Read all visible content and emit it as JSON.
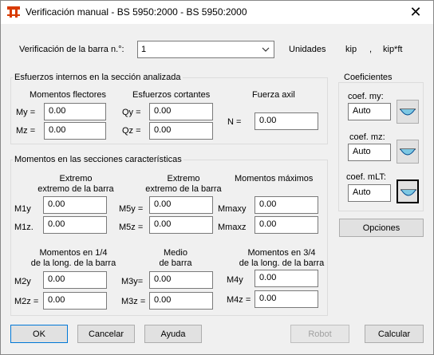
{
  "window": {
    "title": "Verificación manual - BS 5950:2000 - BS 5950:2000"
  },
  "header": {
    "bar_label": "Verificación de la barra n.°:",
    "bar_value": "1",
    "units_label": "Unidades",
    "unit_force": "kip",
    "unit_separator": ",",
    "unit_moment": "kip*ft"
  },
  "internal": {
    "title": "Esfuerzos internos en la sección analizada",
    "moments_title": "Momentos flectores",
    "shear_title": "Esfuerzos cortantes",
    "axial_title": "Fuerza axil",
    "my_label": "My =",
    "mz_label": "Mz =",
    "qy_label": "Qy =",
    "qz_label": "Qz =",
    "n_label": "N =",
    "my_value": "0.00",
    "mz_value": "0.00",
    "qy_value": "0.00",
    "qz_value": "0.00",
    "n_value": "0.00"
  },
  "sections": {
    "title": "Momentos en las secciones características",
    "col1_title_l1": "Extremo",
    "col1_title_l2": "extremo de la barra",
    "col2_title_l1": "Extremo",
    "col2_title_l2": "extremo de la barra",
    "col3_title": "Momentos máximos",
    "m1y_label": "M1y",
    "m1z_label": "M1z.",
    "m5y_label": "M5y =",
    "m5z_label": "M5z =",
    "mmaxy_label": "Mmaxy",
    "mmaxz_label": "Mmaxz",
    "m1y_value": "0.00",
    "m1z_value": "0.00",
    "m5y_value": "0.00",
    "m5z_value": "0.00",
    "mmaxy_value": "0.00",
    "mmaxz_value": "0.00",
    "col4_title_l1": "Momentos en 1/4",
    "col4_title_l2": "de la long. de la barra",
    "col5_title_l1": "Medio",
    "col5_title_l2": "de barra",
    "col6_title_l1": "Momentos en 3/4",
    "col6_title_l2": "de la long. de la barra",
    "m2y_label": "M2y",
    "m2z_label": "M2z =",
    "m3y_label": "M3y=",
    "m3z_label": "M3z =",
    "m4y_label": "M4y",
    "m4z_label": "M4z =",
    "m2y_value": "0.00",
    "m2z_value": "0.00",
    "m3y_value": "0.00",
    "m3z_value": "0.00",
    "m4y_value": "0.00",
    "m4z_value": "0.00"
  },
  "coefficients": {
    "title": "Coeficientes",
    "my_label": "coef. my:",
    "mz_label": "coef. mz:",
    "mlt_label": "coef. mLT:",
    "my_value": "Auto",
    "mz_value": "Auto",
    "mlt_value": "Auto",
    "diagram_icon": "moment-diagram-icon",
    "options_button": "Opciones"
  },
  "footer": {
    "ok": "OK",
    "cancel": "Cancelar",
    "help": "Ayuda",
    "robot": "Robot",
    "calculate": "Calcular"
  }
}
